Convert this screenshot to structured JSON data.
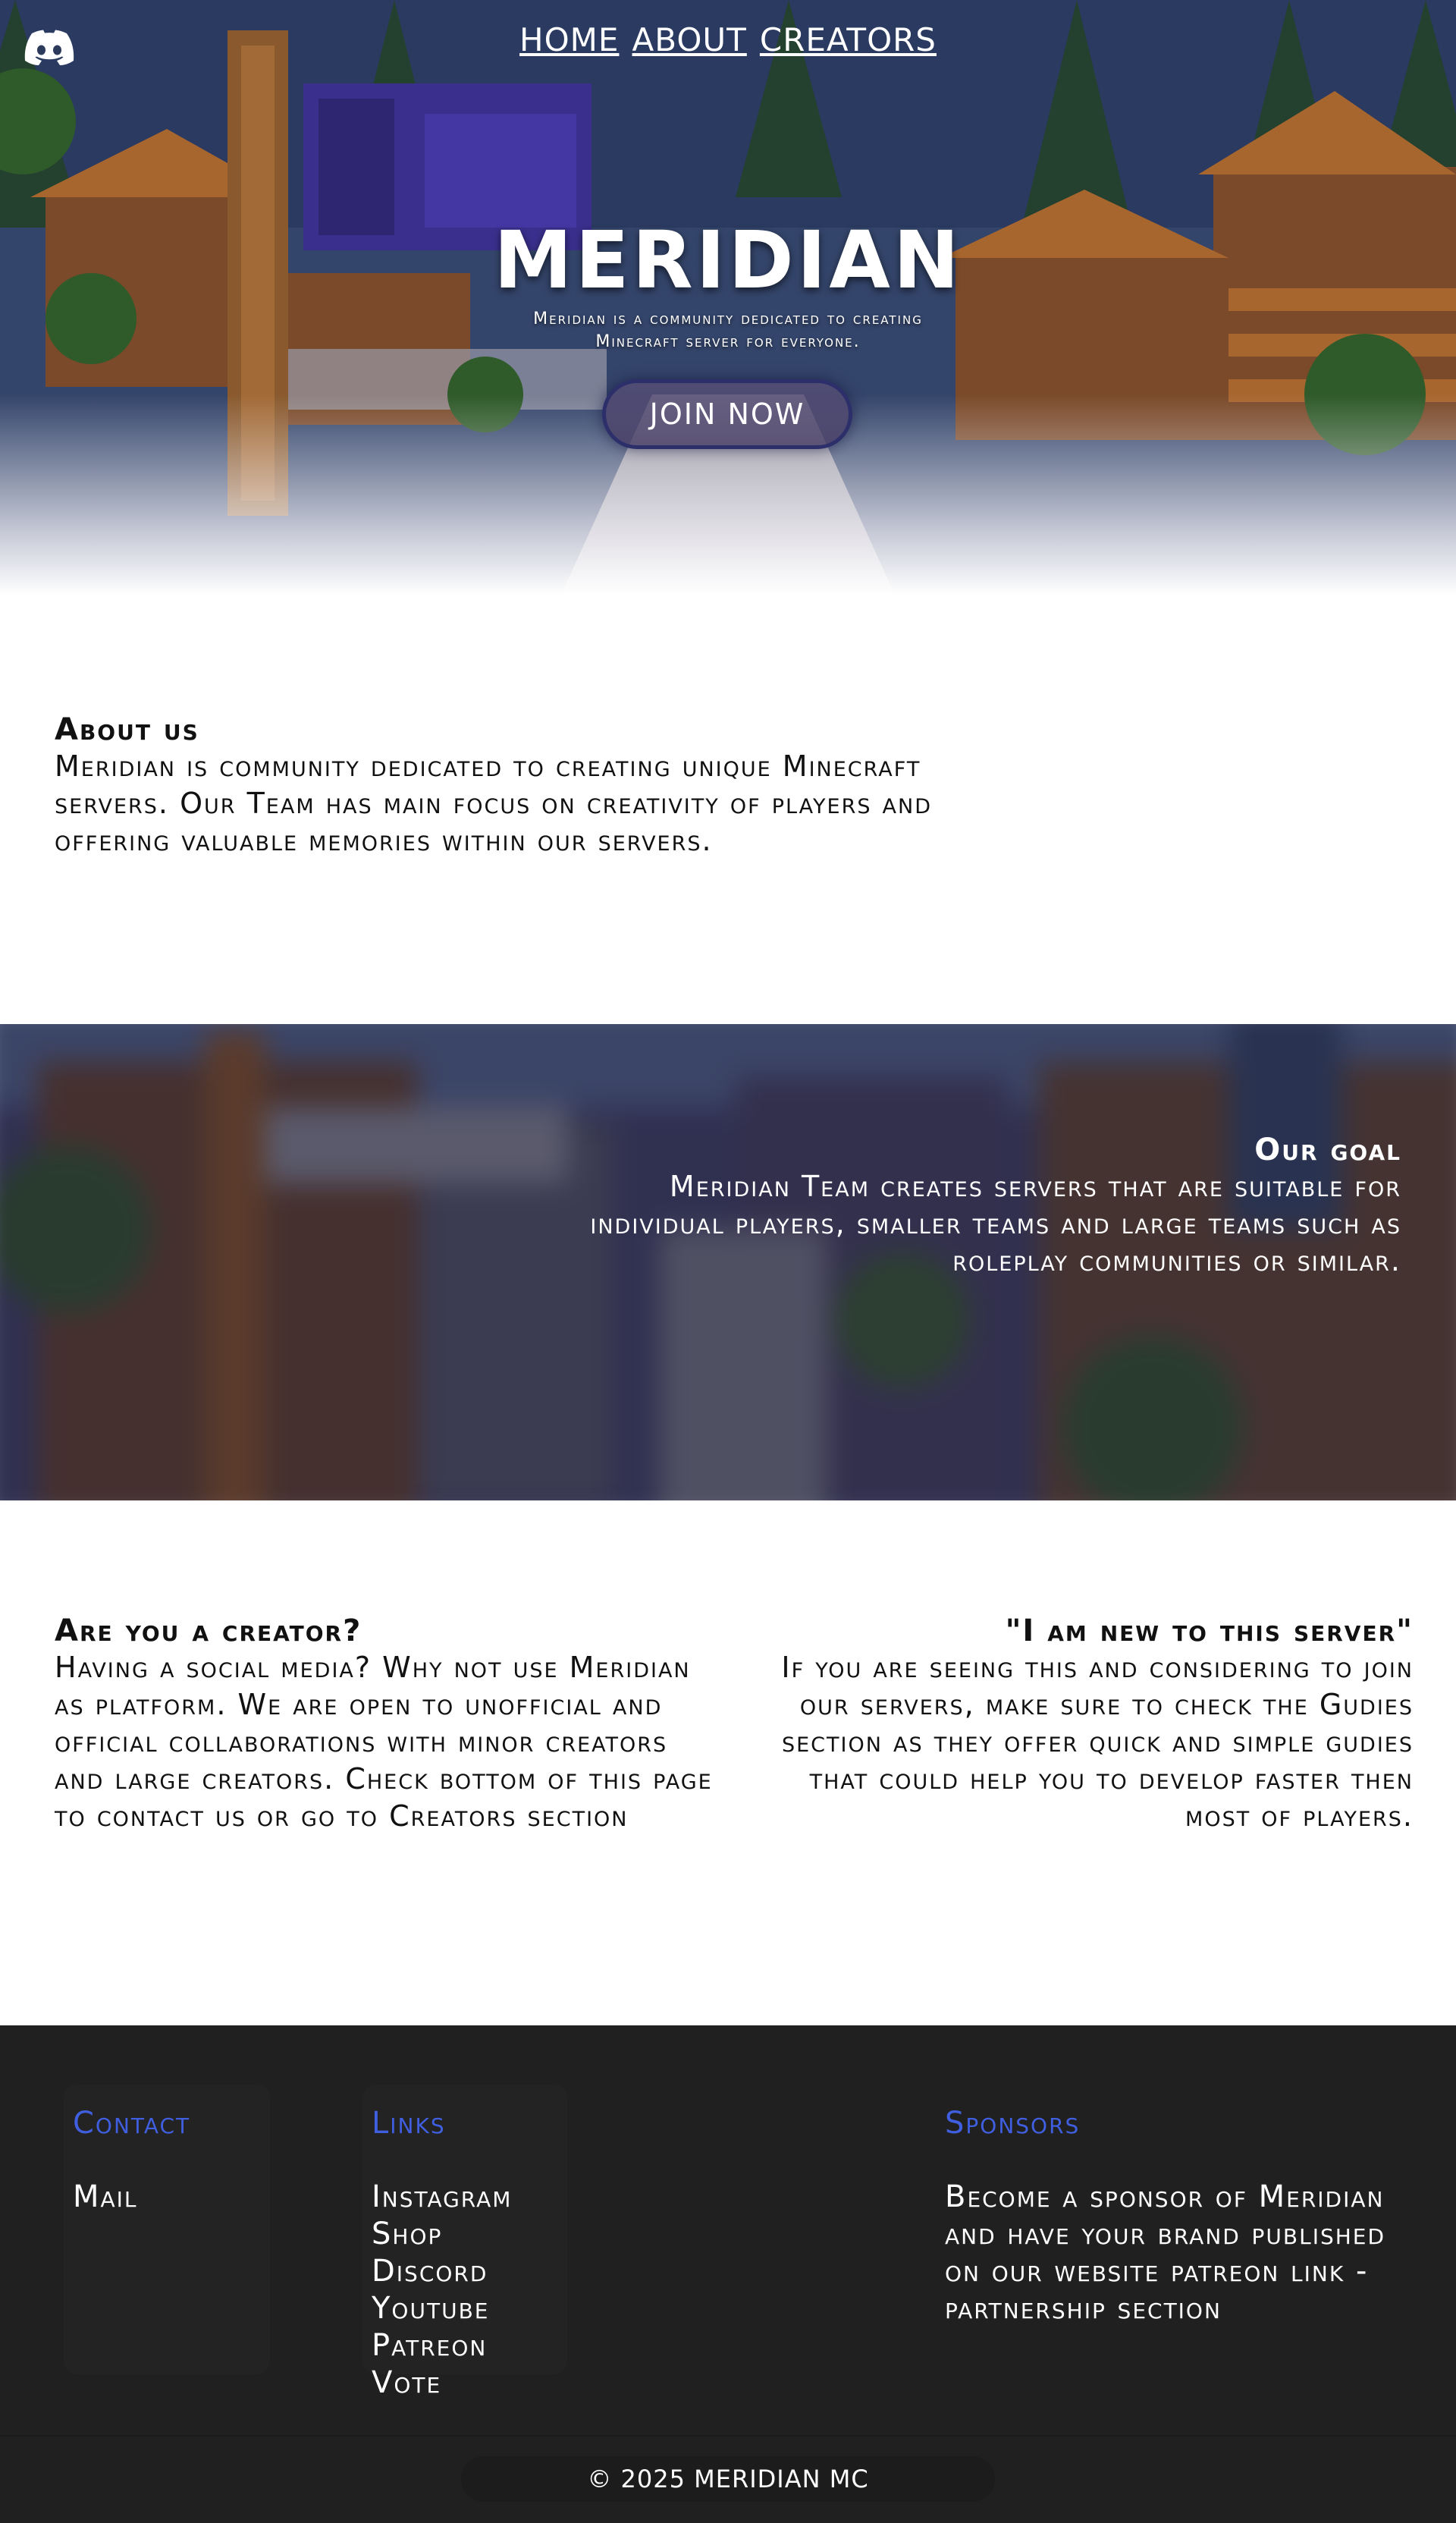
{
  "nav": {
    "links": [
      "HOME",
      "ABOUT",
      "CREATORS"
    ],
    "discord_icon": "discord-icon"
  },
  "hero": {
    "title": "MERIDIAN",
    "subtitle": "Meridian is a community dedicated to creating Minecraft server for everyone.",
    "join_label": "JOIN NOW"
  },
  "about": {
    "heading": "About us",
    "body": "Meridian is community dedicated to creating unique Minecraft servers. Our Team has main focus on creativity of players and offering valuable memories within our servers."
  },
  "goal": {
    "heading": "Our goal",
    "body": "Meridian Team creates servers that are suitable for individual players, smaller teams and large teams such as roleplay communities or similar."
  },
  "creator": {
    "heading": "Are you a creator?",
    "body": "Having a social media? Why not use Meridian as platform. We are open to unofficial and official collaborations with minor creators and large creators. Check bottom of this page to contact us or go to Creators section"
  },
  "newbie": {
    "heading": "\"I am new to this server\"",
    "body": "If you are seeing this and considering to join our servers, make sure to check the Gudies section as they offer quick and simple gudies that could help you to develop faster then most of players."
  },
  "footer": {
    "contact": {
      "heading": "Contact",
      "items": [
        "Mail"
      ]
    },
    "links": {
      "heading": "Links",
      "items": [
        "Instagram",
        "Shop",
        "Discord",
        "Youtube",
        "Patreon",
        "Vote"
      ]
    },
    "sponsors": {
      "heading": "Sponsors",
      "body": "Become a sponsor of Meridian and have your brand published on our website patreon link - partnership section"
    },
    "copyright": "© 2025 MERIDIAN MC"
  },
  "colors": {
    "accent_blue": "#3f5fe0",
    "footer_bg": "#202020",
    "button_border": "#2c2f6a"
  }
}
